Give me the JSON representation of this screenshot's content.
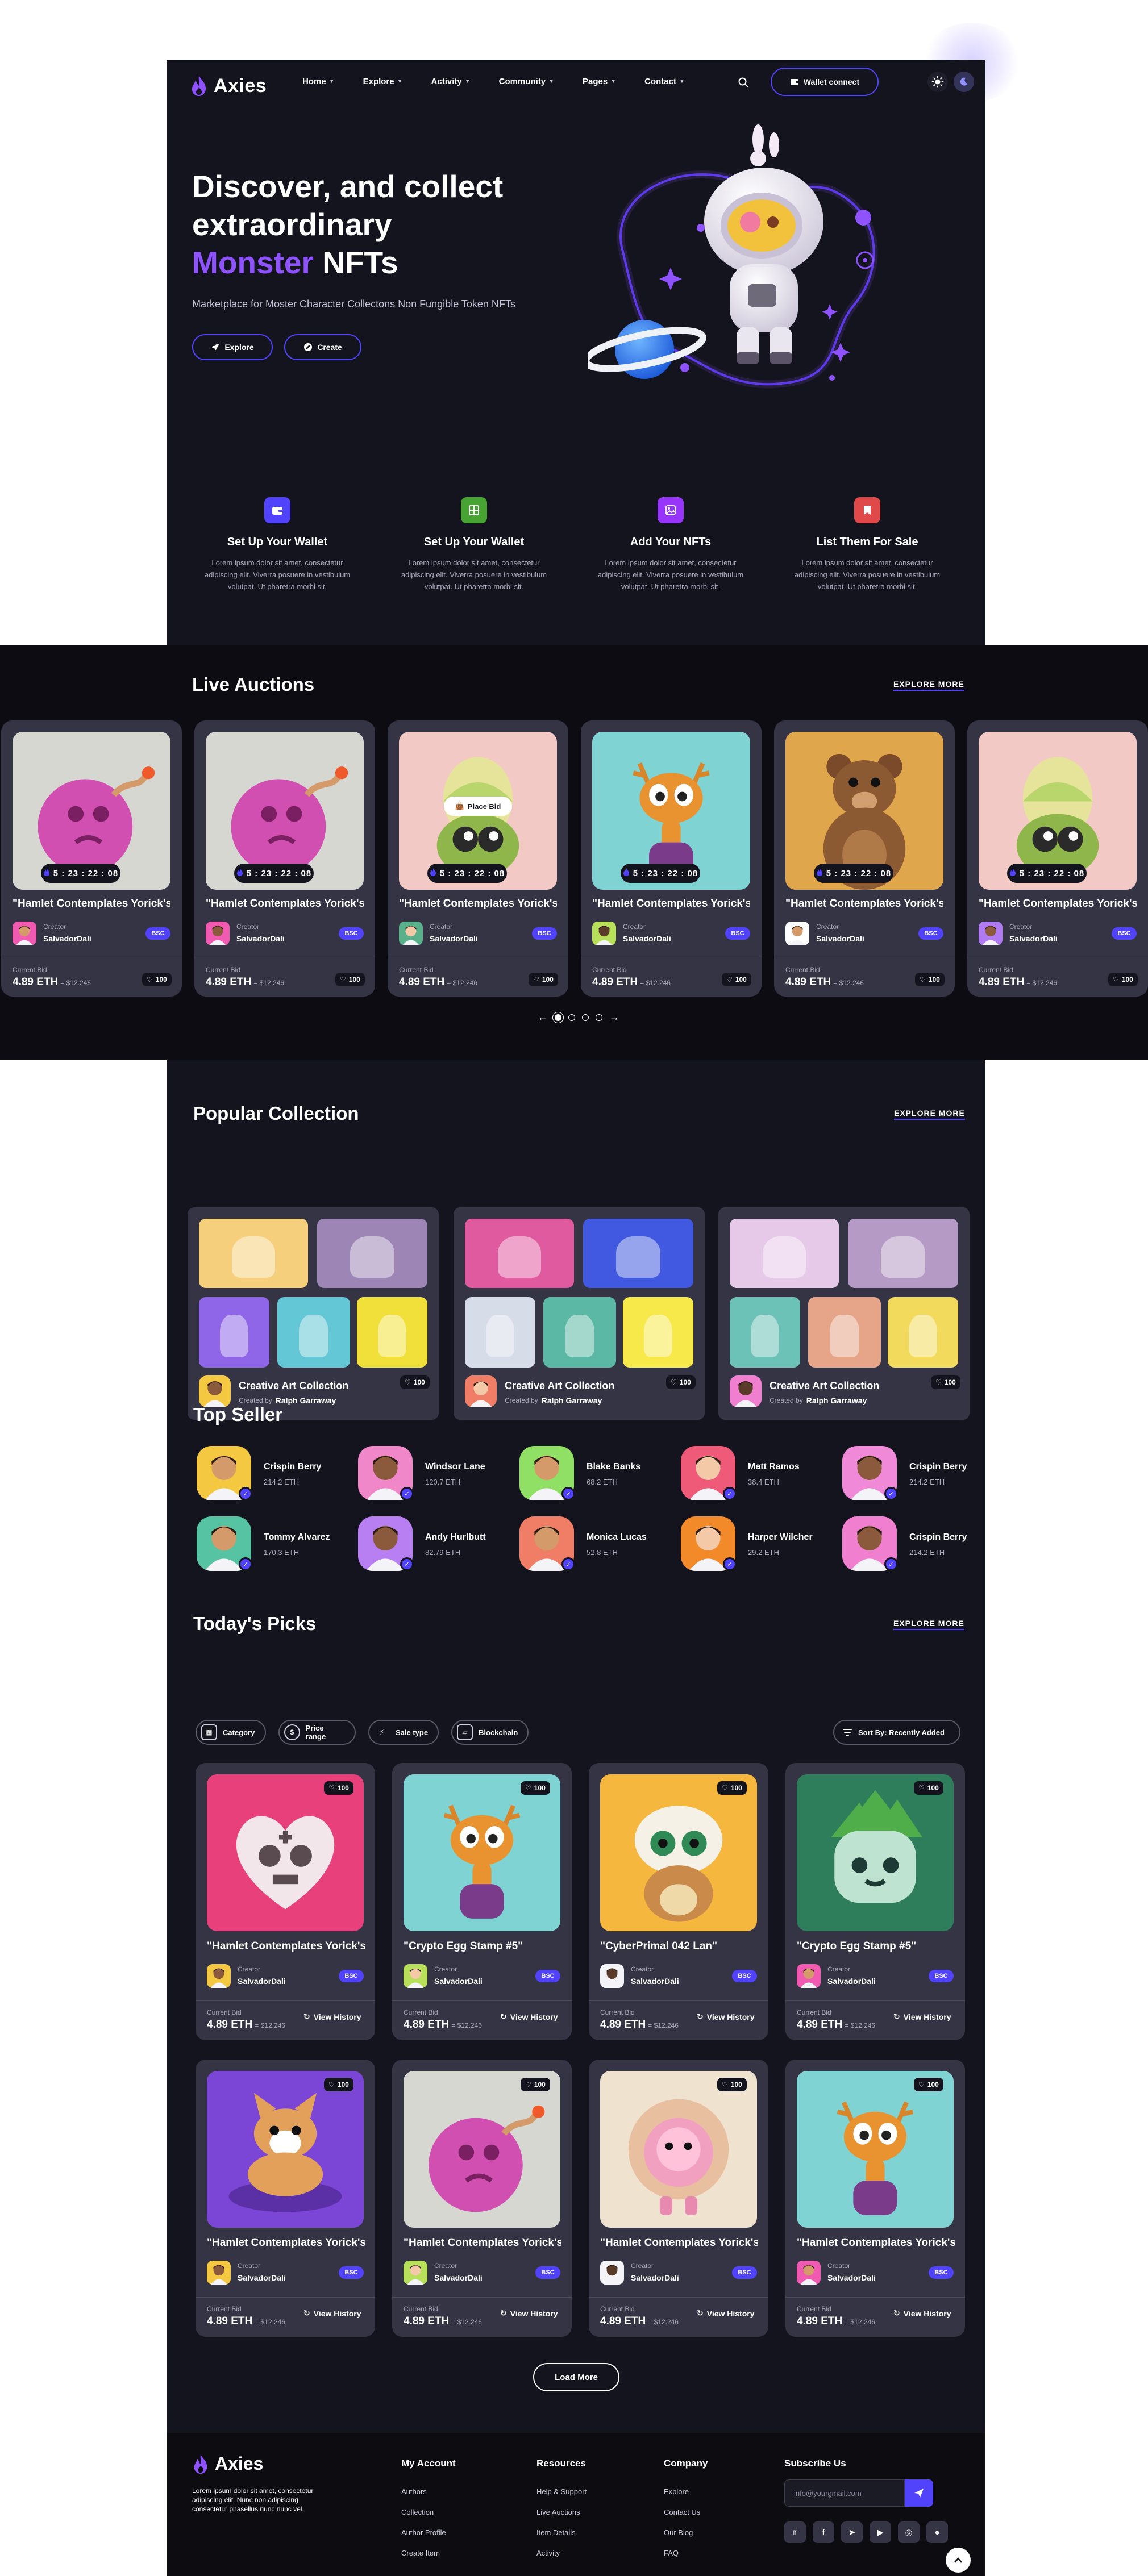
{
  "brand": {
    "name": "Axies"
  },
  "nav": [
    {
      "label": "Home"
    },
    {
      "label": "Explore"
    },
    {
      "label": "Activity"
    },
    {
      "label": "Community"
    },
    {
      "label": "Pages"
    },
    {
      "label": "Contact"
    }
  ],
  "header": {
    "wallet_label": "Wallet connect"
  },
  "hero": {
    "title_line1": "Discover, and collect",
    "title_line2": "extraordinary",
    "title_accent": "Monster",
    "title_end": "NFTs",
    "subtitle": "Marketplace for Moster Character Collectons Non Fungible Token NFTs",
    "explore_label": "Explore",
    "create_label": "Create"
  },
  "steps": [
    {
      "title": "Set Up Your Wallet",
      "desc": "Lorem ipsum dolor sit amet, consectetur adipiscing elit. Viverra posuere in vestibulum volutpat. Ut pharetra morbi sit.",
      "color": "#5142fc"
    },
    {
      "title": "Set Up Your Wallet",
      "desc": "Lorem ipsum dolor sit amet, consectetur adipiscing elit. Viverra posuere in vestibulum volutpat. Ut pharetra morbi sit.",
      "color": "#47a432"
    },
    {
      "title": "Add Your NFTs",
      "desc": "Lorem ipsum dolor sit amet, consectetur adipiscing elit. Viverra posuere in vestibulum volutpat. Ut pharetra morbi sit.",
      "color": "#9835fb"
    },
    {
      "title": "List Them For Sale",
      "desc": "Lorem ipsum dolor sit amet, consectetur adipiscing elit. Viverra posuere in vestibulum volutpat. Ut pharetra morbi sit.",
      "color": "#df4949"
    }
  ],
  "live": {
    "title": "Live Auctions",
    "explore_label": "EXPLORE MORE",
    "place_bid": "Place Bid",
    "cards": [
      {
        "title": "\"Hamlet Contemplates Yorick's Yorick's",
        "timer": "5 : 23 : 22 : 08",
        "creator_label": "Creator",
        "creator": "SalvadorDali",
        "badge": "BSC",
        "bid_label": "Current Bid",
        "price": "4.89 ETH",
        "usd": "= $12.246",
        "likes": "100",
        "bg": "#d7d7d2",
        "art": "bomb"
      },
      {
        "title": "\"Hamlet Contemplates Yorick's Yorick's",
        "timer": "5 : 23 : 22 : 08",
        "creator_label": "Creator",
        "creator": "SalvadorDali",
        "badge": "BSC",
        "bid_label": "Current Bid",
        "price": "4.89 ETH",
        "usd": "= $12.246",
        "likes": "100",
        "bg": "#d7d7d2",
        "art": "bomb"
      },
      {
        "title": "\"Hamlet Contemplates Yorick's Yorick's",
        "timer": "5 : 23 : 22 : 08",
        "creator_label": "Creator",
        "creator": "SalvadorDali",
        "badge": "BSC",
        "bid_label": "Current Bid",
        "price": "4.89 ETH",
        "usd": "= $12.246",
        "likes": "100",
        "bg": "#f2c9c4",
        "art": "plant"
      },
      {
        "title": "\"Hamlet Contemplates Yorick's Yorick's",
        "timer": "5 : 23 : 22 : 08",
        "creator_label": "Creator",
        "creator": "SalvadorDali",
        "badge": "BSC",
        "bid_label": "Current Bid",
        "price": "4.89 ETH",
        "usd": "= $12.246",
        "likes": "100",
        "bg": "#7fd3d3",
        "art": "deer"
      },
      {
        "title": "\"Hamlet Contemplates Yorick's Yorick's",
        "timer": "5 : 23 : 22 : 08",
        "creator_label": "Creator",
        "creator": "SalvadorDali",
        "badge": "BSC",
        "bid_label": "Current Bid",
        "price": "4.89 ETH",
        "usd": "= $12.246",
        "likes": "100",
        "bg": "#e0a64b",
        "art": "bear"
      },
      {
        "title": "\"Hamlet Contemplates Yorick's Yorick's",
        "timer": "5 : 23 : 22 : 08",
        "creator_label": "Creator",
        "creator": "SalvadorDali",
        "badge": "BSC",
        "bid_label": "Current Bid",
        "price": "4.89 ETH",
        "usd": "= $12.246",
        "likes": "100",
        "bg": "#f2c9c4",
        "art": "plant"
      }
    ]
  },
  "popular": {
    "title": "Popular Collection",
    "explore_label": "EXPLORE MORE",
    "items": [
      {
        "name": "Creative Art Collection",
        "by_label": "Created by",
        "author": "Ralph Garraway",
        "likes": "100",
        "tiles": [
          "#f6cf7c",
          "#9d86b6",
          "#8f66e8",
          "#63c7d6",
          "#f2e03a"
        ]
      },
      {
        "name": "Creative Art Collection",
        "by_label": "Created by",
        "author": "Ralph Garraway",
        "likes": "100",
        "tiles": [
          "#e05aa0",
          "#4059e0",
          "#d6dde8",
          "#5ab8a4",
          "#f7e94a"
        ]
      },
      {
        "name": "Creative Art Collection",
        "by_label": "Created by",
        "author": "Ralph Garraway",
        "likes": "100",
        "tiles": [
          "#e6c9e8",
          "#b49ac4",
          "#6cc2b7",
          "#e6a488",
          "#f2da5c"
        ]
      }
    ]
  },
  "sellers": {
    "title": "Top Seller",
    "items": [
      {
        "name": "Crispin Berry",
        "eth": "214.2 ETH",
        "bg": "#f5c842"
      },
      {
        "name": "Windsor Lane",
        "eth": "120.7 ETH",
        "bg": "#f087c9"
      },
      {
        "name": "Blake Banks",
        "eth": "68.2 ETH",
        "bg": "#8fe065"
      },
      {
        "name": "Matt Ramos",
        "eth": "38.4 ETH",
        "bg": "#f05a79"
      },
      {
        "name": "Crispin Berry",
        "eth": "214.2 ETH",
        "bg": "#f08ad8"
      },
      {
        "name": "Tommy Alvarez",
        "eth": "170.3 ETH",
        "bg": "#56c4a3"
      },
      {
        "name": "Andy Hurlbutt",
        "eth": "82.79 ETH",
        "bg": "#b87ff2"
      },
      {
        "name": "Monica Lucas",
        "eth": "52.8 ETH",
        "bg": "#f07d66"
      },
      {
        "name": "Harper Wilcher",
        "eth": "29.2 ETH",
        "bg": "#f28a2a"
      },
      {
        "name": "Crispin Berry",
        "eth": "214.2 ETH",
        "bg": "#f07fcf"
      }
    ]
  },
  "picks": {
    "title": "Today's Picks",
    "explore_label": "EXPLORE MORE",
    "filters": [
      {
        "label": "Category"
      },
      {
        "label": "Price range"
      },
      {
        "label": "Sale type"
      },
      {
        "label": "Blockchain"
      }
    ],
    "sort_label": "Sort By: Recently Added",
    "history_label": "View History",
    "cards": [
      {
        "title": "\"Hamlet Contemplates Yorick's Yorick's",
        "creator_label": "Creator",
        "creator": "SalvadorDali",
        "badge": "BSC",
        "bid_label": "Current Bid",
        "price": "4.89 ETH",
        "usd": "= $12.246",
        "likes": "100",
        "bg": "#e8407a",
        "art": "skull"
      },
      {
        "title": "\"Crypto Egg Stamp #5\"",
        "creator_label": "Creator",
        "creator": "SalvadorDali",
        "badge": "BSC",
        "bid_label": "Current Bid",
        "price": "4.89 ETH",
        "usd": "= $12.246",
        "likes": "100",
        "bg": "#7fd3d3",
        "art": "deer"
      },
      {
        "title": "\"CyberPrimal 042 Lan\"",
        "creator_label": "Creator",
        "creator": "SalvadorDali",
        "badge": "BSC",
        "bid_label": "Current Bid",
        "price": "4.89 ETH",
        "usd": "= $12.246",
        "likes": "100",
        "bg": "#f5b73e",
        "art": "cubone"
      },
      {
        "title": "\"Crypto Egg Stamp #5\"",
        "creator_label": "Creator",
        "creator": "SalvadorDali",
        "badge": "BSC",
        "bid_label": "Current Bid",
        "price": "4.89 ETH",
        "usd": "= $12.246",
        "likes": "100",
        "bg": "#2e7d5b",
        "art": "bulba"
      },
      {
        "title": "\"Hamlet Contemplates Yorick's Yorick's",
        "creator_label": "Creator",
        "creator": "SalvadorDali",
        "badge": "BSC",
        "bid_label": "Current Bid",
        "price": "4.89 ETH",
        "usd": "= $12.246",
        "likes": "100",
        "bg": "#7b45d6",
        "art": "corgi"
      },
      {
        "title": "\"Hamlet Contemplates Yorick's Yorick's",
        "creator_label": "Creator",
        "creator": "SalvadorDali",
        "badge": "BSC",
        "bid_label": "Current Bid",
        "price": "4.89 ETH",
        "usd": "= $12.246",
        "likes": "100",
        "bg": "#d7d7d2",
        "art": "bomb"
      },
      {
        "title": "\"Hamlet Contemplates Yorick's Yorick's",
        "creator_label": "Creator",
        "creator": "SalvadorDali",
        "badge": "BSC",
        "bid_label": "Current Bid",
        "price": "4.89 ETH",
        "usd": "= $12.246",
        "likes": "100",
        "bg": "#efe2cf",
        "art": "pig"
      },
      {
        "title": "\"Hamlet Contemplates Yorick's Yorick's",
        "creator_label": "Creator",
        "creator": "SalvadorDali",
        "badge": "BSC",
        "bid_label": "Current Bid",
        "price": "4.89 ETH",
        "usd": "= $12.246",
        "likes": "100",
        "bg": "#7fd3d3",
        "art": "deer"
      }
    ],
    "load_more": "Load More"
  },
  "footer": {
    "brand": "Axies",
    "about": "Lorem ipsum dolor sit amet, consectetur adipiscing elit. Nunc non adipiscing consectetur phasellus nunc nunc vel.",
    "cols": [
      {
        "title": "My Account",
        "links": [
          "Authors",
          "Collection",
          "Author Profile",
          "Create Item"
        ]
      },
      {
        "title": "Resources",
        "links": [
          "Help & Support",
          "Live Auctions",
          "Item Details",
          "Activity"
        ]
      },
      {
        "title": "Company",
        "links": [
          "Explore",
          "Contact Us",
          "Our Blog",
          "FAQ"
        ]
      }
    ],
    "subscribe_title": "Subscribe Us",
    "email_placeholder": "info@yourgmail.com",
    "socials": [
      "twitter-icon",
      "facebook-icon",
      "telegram-icon",
      "youtube-icon",
      "instagram-icon",
      "discord-icon"
    ]
  }
}
